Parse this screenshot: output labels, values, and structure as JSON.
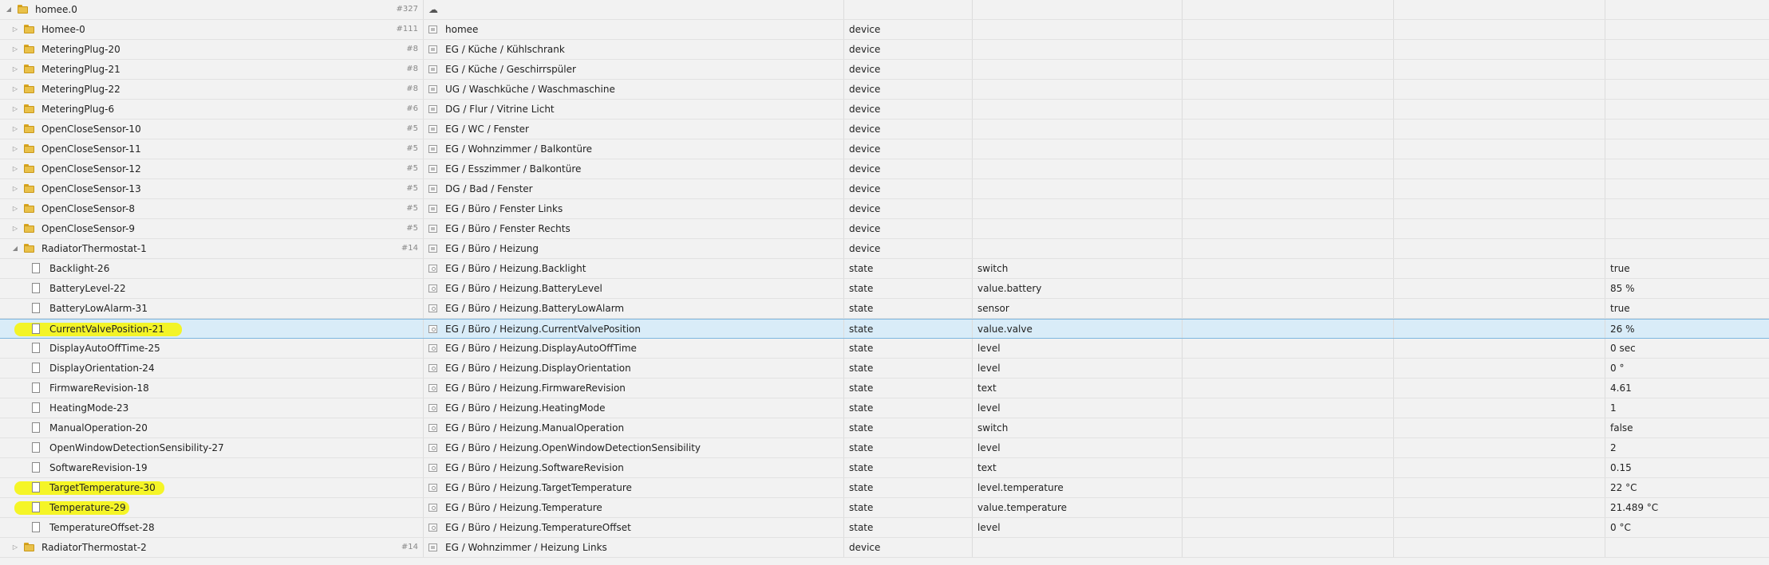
{
  "colors": {
    "highlight": "#f5f511",
    "selected_row": "#d9ecf8",
    "folder": "#e9c14a"
  },
  "root": {
    "id": "homee.0",
    "count": "#327",
    "name_icon": "cloud-icon"
  },
  "rows": [
    {
      "kind": "folder",
      "level": 1,
      "toggle": "▷",
      "id": "Homee-0",
      "count": "#111",
      "name": "homee",
      "type": "device",
      "role": "",
      "value": ""
    },
    {
      "kind": "folder",
      "level": 1,
      "toggle": "▷",
      "id": "MeteringPlug-20",
      "count": "#8",
      "name": "EG / Küche / Kühlschrank",
      "type": "device",
      "role": "",
      "value": ""
    },
    {
      "kind": "folder",
      "level": 1,
      "toggle": "▷",
      "id": "MeteringPlug-21",
      "count": "#8",
      "name": "EG / Küche / Geschirrspüler",
      "type": "device",
      "role": "",
      "value": ""
    },
    {
      "kind": "folder",
      "level": 1,
      "toggle": "▷",
      "id": "MeteringPlug-22",
      "count": "#8",
      "name": "UG / Waschküche / Waschmaschine",
      "type": "device",
      "role": "",
      "value": ""
    },
    {
      "kind": "folder",
      "level": 1,
      "toggle": "▷",
      "id": "MeteringPlug-6",
      "count": "#6",
      "name": "DG / Flur / Vitrine Licht",
      "type": "device",
      "role": "",
      "value": ""
    },
    {
      "kind": "folder",
      "level": 1,
      "toggle": "▷",
      "id": "OpenCloseSensor-10",
      "count": "#5",
      "name": "EG / WC / Fenster",
      "type": "device",
      "role": "",
      "value": ""
    },
    {
      "kind": "folder",
      "level": 1,
      "toggle": "▷",
      "id": "OpenCloseSensor-11",
      "count": "#5",
      "name": "EG / Wohnzimmer / Balkontüre",
      "type": "device",
      "role": "",
      "value": ""
    },
    {
      "kind": "folder",
      "level": 1,
      "toggle": "▷",
      "id": "OpenCloseSensor-12",
      "count": "#5",
      "name": "EG / Esszimmer / Balkontüre",
      "type": "device",
      "role": "",
      "value": ""
    },
    {
      "kind": "folder",
      "level": 1,
      "toggle": "▷",
      "id": "OpenCloseSensor-13",
      "count": "#5",
      "name": "DG / Bad / Fenster",
      "type": "device",
      "role": "",
      "value": ""
    },
    {
      "kind": "folder",
      "level": 1,
      "toggle": "▷",
      "id": "OpenCloseSensor-8",
      "count": "#5",
      "name": "EG / Büro / Fenster Links",
      "type": "device",
      "role": "",
      "value": ""
    },
    {
      "kind": "folder",
      "level": 1,
      "toggle": "▷",
      "id": "OpenCloseSensor-9",
      "count": "#5",
      "name": "EG / Büro / Fenster Rechts",
      "type": "device",
      "role": "",
      "value": ""
    },
    {
      "kind": "folder",
      "level": 1,
      "toggle": "◢",
      "id": "RadiatorThermostat-1",
      "count": "#14",
      "name": "EG / Büro / Heizung",
      "type": "device",
      "role": "",
      "value": ""
    },
    {
      "kind": "state",
      "level": 2,
      "id": "Backlight-26",
      "name": "EG / Büro / Heizung.Backlight",
      "type": "state",
      "role": "switch",
      "value": "true"
    },
    {
      "kind": "state",
      "level": 2,
      "id": "BatteryLevel-22",
      "name": "EG / Büro / Heizung.BatteryLevel",
      "type": "state",
      "role": "value.battery",
      "value": "85 %"
    },
    {
      "kind": "state",
      "level": 2,
      "id": "BatteryLowAlarm-31",
      "name": "EG / Büro / Heizung.BatteryLowAlarm",
      "type": "state",
      "role": "sensor",
      "value": "true"
    },
    {
      "kind": "state",
      "level": 2,
      "id": "CurrentValvePosition-21",
      "name": "EG / Büro / Heizung.CurrentValvePosition",
      "type": "state",
      "role": "value.valve",
      "value": "26 %",
      "selected": true,
      "highlight": true
    },
    {
      "kind": "state",
      "level": 2,
      "id": "DisplayAutoOffTime-25",
      "name": "EG / Büro / Heizung.DisplayAutoOffTime",
      "type": "state",
      "role": "level",
      "value": "0 sec"
    },
    {
      "kind": "state",
      "level": 2,
      "id": "DisplayOrientation-24",
      "name": "EG / Büro / Heizung.DisplayOrientation",
      "type": "state",
      "role": "level",
      "value": "0 °"
    },
    {
      "kind": "state",
      "level": 2,
      "id": "FirmwareRevision-18",
      "name": "EG / Büro / Heizung.FirmwareRevision",
      "type": "state",
      "role": "text",
      "value": "4.61"
    },
    {
      "kind": "state",
      "level": 2,
      "id": "HeatingMode-23",
      "name": "EG / Büro / Heizung.HeatingMode",
      "type": "state",
      "role": "level",
      "value": "1"
    },
    {
      "kind": "state",
      "level": 2,
      "id": "ManualOperation-20",
      "name": "EG / Büro / Heizung.ManualOperation",
      "type": "state",
      "role": "switch",
      "value": "false"
    },
    {
      "kind": "state",
      "level": 2,
      "id": "OpenWindowDetectionSensibility-27",
      "name": "EG / Büro / Heizung.OpenWindowDetectionSensibility",
      "type": "state",
      "role": "level",
      "value": "2"
    },
    {
      "kind": "state",
      "level": 2,
      "id": "SoftwareRevision-19",
      "name": "EG / Büro / Heizung.SoftwareRevision",
      "type": "state",
      "role": "text",
      "value": "0.15"
    },
    {
      "kind": "state",
      "level": 2,
      "id": "TargetTemperature-30",
      "name": "EG / Büro / Heizung.TargetTemperature",
      "type": "state",
      "role": "level.temperature",
      "value": "22 °C",
      "highlight": true
    },
    {
      "kind": "state",
      "level": 2,
      "id": "Temperature-29",
      "name": "EG / Büro / Heizung.Temperature",
      "type": "state",
      "role": "value.temperature",
      "value": "21.489 °C",
      "highlight": true
    },
    {
      "kind": "state",
      "level": 2,
      "id": "TemperatureOffset-28",
      "name": "EG / Büro / Heizung.TemperatureOffset",
      "type": "state",
      "role": "level",
      "value": "0 °C"
    },
    {
      "kind": "folder",
      "level": 1,
      "toggle": "▷",
      "id": "RadiatorThermostat-2",
      "count": "#14",
      "name": "EG / Wohnzimmer / Heizung Links",
      "type": "device",
      "role": "",
      "value": ""
    }
  ]
}
